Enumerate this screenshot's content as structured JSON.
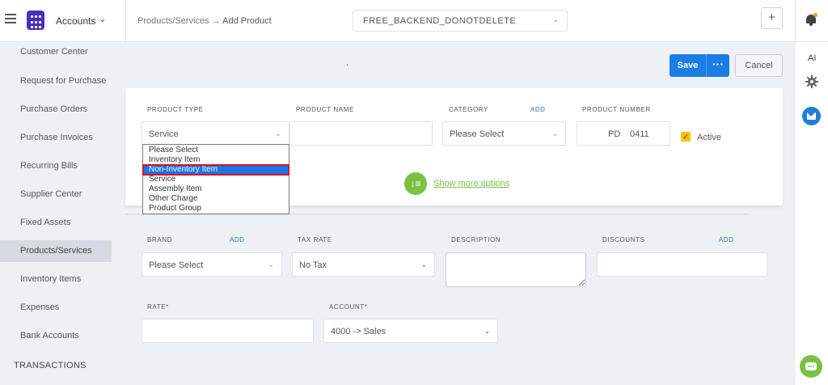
{
  "topbar": {
    "app_name": "Accounts",
    "breadcrumb_parent": "Products/Services",
    "breadcrumb_sep": "→",
    "breadcrumb_current": "Add Product",
    "company": "FREE_BACKEND_DONOTDELETE",
    "plus": "+"
  },
  "right_rail": {
    "ai": "AI"
  },
  "sidebar": {
    "items": [
      {
        "label": "Customer Center"
      },
      {
        "label": "Request for Purchase"
      },
      {
        "label": "Purchase Orders"
      },
      {
        "label": "Purchase Invoices"
      },
      {
        "label": "Recurring Bills"
      },
      {
        "label": "Supplier Center"
      },
      {
        "label": "Fixed Assets"
      },
      {
        "label": "Products/Services",
        "active": true
      },
      {
        "label": "Inventory Items"
      },
      {
        "label": "Expenses"
      },
      {
        "label": "Bank Accounts"
      }
    ],
    "section": "TRANSACTIONS"
  },
  "actions": {
    "save": "Save",
    "more": "···",
    "cancel": "Cancel",
    "dot": "."
  },
  "form": {
    "product_type": {
      "label": "PRODUCT TYPE",
      "value": "Service"
    },
    "product_name": {
      "label": "PRODUCT NAME",
      "value": ""
    },
    "category": {
      "label": "CATEGORY",
      "add": "ADD",
      "value": "Please Select"
    },
    "product_number": {
      "label": "PRODUCT NUMBER",
      "prefix": "PD",
      "value": "0411"
    },
    "active": {
      "label": "Active",
      "checked": true
    },
    "show_more": "Show more options",
    "brand": {
      "label": "BRAND",
      "add": "ADD",
      "value": "Please Select"
    },
    "tax_rate": {
      "label": "TAX RATE",
      "value": "No Tax"
    },
    "description": {
      "label": "DESCRIPTION",
      "value": ""
    },
    "discounts": {
      "label": "DISCOUNTS",
      "add": "ADD",
      "value": ""
    },
    "rate": {
      "label": "RATE*",
      "value": ""
    },
    "account": {
      "label": "ACCOUNT*",
      "value": "4000 -> Sales"
    }
  },
  "product_type_options": [
    "Please Select",
    "Inventory Item",
    "Non-Inventory Item",
    "Service",
    "Assembly Item",
    "Other Charge",
    "Product Group"
  ],
  "product_type_highlighted": "Non-Inventory Item",
  "colors": {
    "primary": "#1a7ee4",
    "accent_green": "#7bc144",
    "brand_purple": "#4a2fb8",
    "highlight_red": "#d4141c"
  }
}
